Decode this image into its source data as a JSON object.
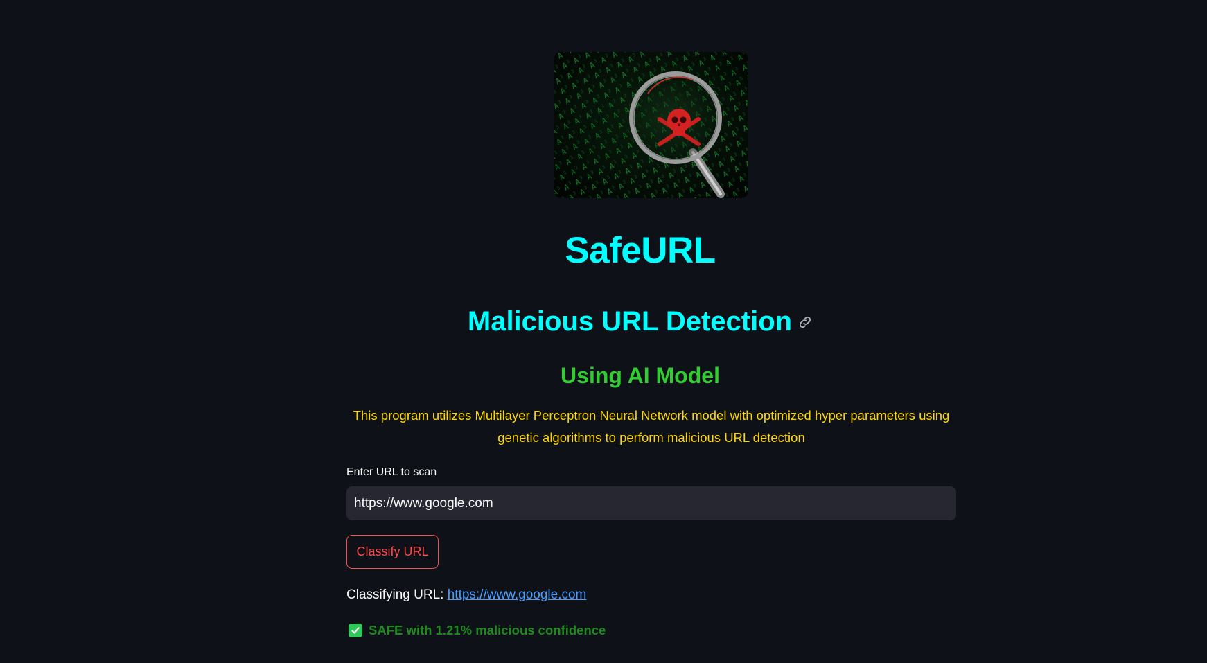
{
  "app": {
    "title": "SafeURL",
    "subtitle": "Malicious URL Detection",
    "tagline": "Using AI Model",
    "description": "This program utilizes Multilayer Perceptron Neural Network model with optimized hyper parameters using genetic algorithms to perform malicious URL detection"
  },
  "hero_image": {
    "icon": "magnifier-skull-icon",
    "alt": "magnifying glass over code with skull"
  },
  "form": {
    "label": "Enter URL to scan",
    "url_value": "https://www.google.com",
    "button_label": "Classify URL"
  },
  "status": {
    "classifying_prefix": "Classifying URL:",
    "classifying_url": "https://www.google.com",
    "result_text": "SAFE with 1.21% malicious confidence",
    "result_icon": "check-icon"
  },
  "colors": {
    "background": "#0e1117",
    "title": "#00ffff",
    "tagline": "#32cd32",
    "description": "#ffd700",
    "button_accent": "#ff4b4b",
    "link": "#4a9eff",
    "safe": "#1e8b1e"
  }
}
